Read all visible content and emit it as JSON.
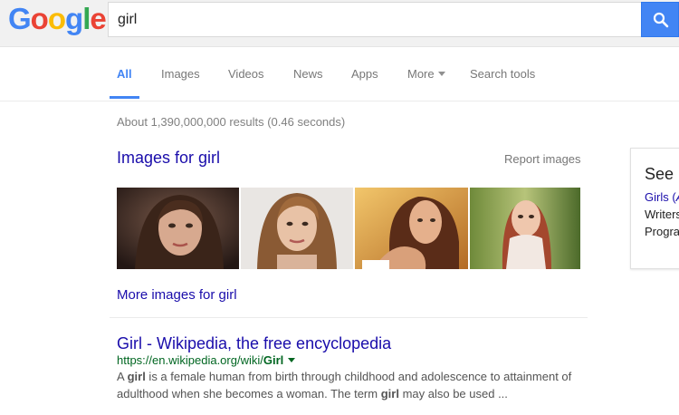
{
  "logo": {
    "letters": [
      "G",
      "o",
      "o",
      "g",
      "l",
      "e"
    ],
    "colors": [
      "#4285f4",
      "#ea4335",
      "#fbbc05",
      "#4285f4",
      "#34a853",
      "#ea4335"
    ]
  },
  "search": {
    "query": "girl"
  },
  "tabs": [
    {
      "label": "All",
      "active": true
    },
    {
      "label": "Images"
    },
    {
      "label": "Videos"
    },
    {
      "label": "News"
    },
    {
      "label": "Apps"
    },
    {
      "label": "More"
    },
    {
      "label": "Search tools"
    }
  ],
  "result_stats": "About 1,390,000,000 results (0.46 seconds)",
  "images_block": {
    "title": "Images for girl",
    "report": "Report images",
    "more": "More images for girl"
  },
  "result": {
    "title": "Girl - Wikipedia, the free encyclopedia",
    "url_prefix": "https://en.wikipedia.org/wiki/",
    "url_bold": "Girl",
    "snippet_1a": "A ",
    "snippet_1b": "girl",
    "snippet_1c": " is a female human from birth through childhood and adolescence to attainment of",
    "snippet_2a": "adulthood when she becomes a woman. The term ",
    "snippet_2b": "girl",
    "snippet_2c": " may also be used ..."
  },
  "knowledge_panel": {
    "title": "See",
    "line1": "Girls (",
    "line2": "Writers",
    "line3": "Progra"
  },
  "colors": {
    "link": "#1a0dab",
    "url": "#006621",
    "accent": "#4285f4"
  }
}
